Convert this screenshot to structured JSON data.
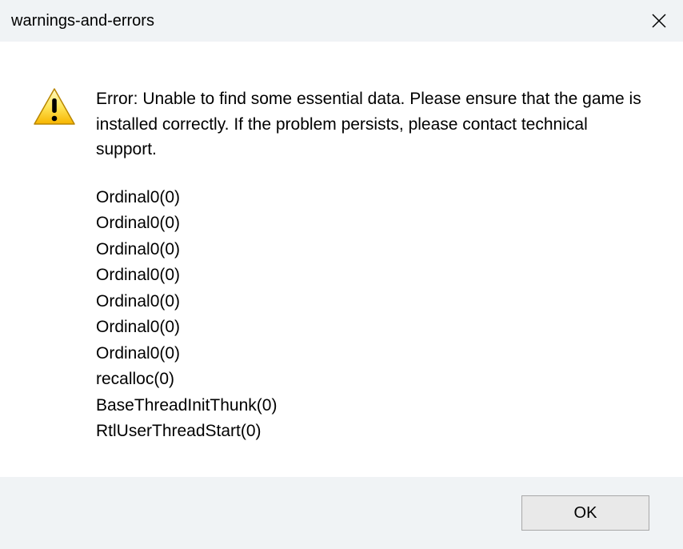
{
  "titlebar": {
    "title": "warnings-and-errors"
  },
  "message": {
    "error_text": "Error: Unable to find some essential data. Please ensure that the game is installed correctly. If the problem persists, please contact technical support.",
    "stack": [
      "Ordinal0(0)",
      "Ordinal0(0)",
      "Ordinal0(0)",
      "Ordinal0(0)",
      "Ordinal0(0)",
      "Ordinal0(0)",
      "Ordinal0(0)",
      "recalloc(0)",
      "BaseThreadInitThunk(0)",
      "RtlUserThreadStart(0)"
    ]
  },
  "footer": {
    "ok_label": "OK"
  },
  "icons": {
    "close": "close-icon",
    "warning": "warning-icon"
  }
}
